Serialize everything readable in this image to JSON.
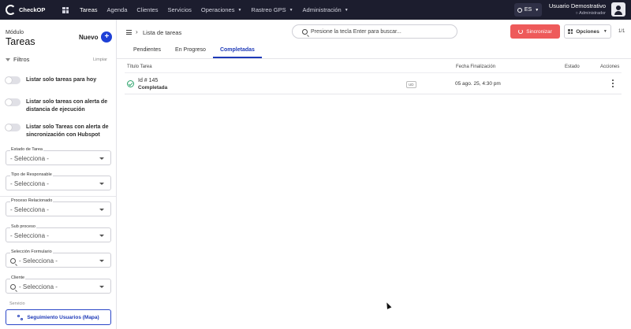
{
  "brand": {
    "name": "CheckOP"
  },
  "nav": {
    "items": [
      {
        "label": "Tareas",
        "active": true,
        "dropdown": false
      },
      {
        "label": "Agenda",
        "active": false,
        "dropdown": false
      },
      {
        "label": "Clientes",
        "active": false,
        "dropdown": false
      },
      {
        "label": "Servicios",
        "active": false,
        "dropdown": false
      },
      {
        "label": "Operaciones",
        "active": false,
        "dropdown": true
      },
      {
        "label": "Rastreo GPS",
        "active": false,
        "dropdown": true
      },
      {
        "label": "Administración",
        "active": false,
        "dropdown": true
      }
    ],
    "language": "ES",
    "user_name": "Usuario Demostrativo",
    "user_role": "Administrador"
  },
  "sidebar": {
    "module_label": "Módulo",
    "module_title": "Tareas",
    "new_label": "Nuevo",
    "filters_label": "Filtros",
    "clear_label": "Limpiar",
    "toggles": [
      {
        "label": "Listar solo tareas para hoy",
        "on": false
      },
      {
        "label": "Listar solo tareas con alerta de distancia de ejecución",
        "on": false
      },
      {
        "label": "Listar solo Tareas con alerta de sincronización con Hubspot",
        "on": false
      }
    ],
    "selects": [
      {
        "label": "Estado de Tarea",
        "value": "- Selecciona -",
        "search": false
      },
      {
        "label": "Tipo de Responsable",
        "value": "- Selecciona -",
        "search": false
      },
      {
        "label": "Proceso Relacionado",
        "value": "- Selecciona -",
        "search": false
      },
      {
        "label": "Sub proceso",
        "value": "- Selecciona -",
        "search": false
      },
      {
        "label": "Selección Formulario",
        "value": "- Selecciona -",
        "search": true
      },
      {
        "label": "Cliente",
        "value": "- Selecciona -",
        "search": true
      }
    ],
    "cut_label": "Servicio",
    "map_button": "Seguimiento Usuarios (Mapa)"
  },
  "main": {
    "breadcrumb": "Lista de tareas",
    "search_placeholder": "Presione la tecla Enter para buscar...",
    "sync_label": "Sincronizar",
    "options_label": "Opciones",
    "pager": "1/1",
    "tabs": [
      {
        "label": "Pendientes",
        "active": false
      },
      {
        "label": "En Progreso",
        "active": false
      },
      {
        "label": "Completadas",
        "active": true
      }
    ],
    "columns": {
      "title": "Título Tarea",
      "end_date": "Fecha Finalización",
      "status": "Estado",
      "actions": "Acciones"
    },
    "rows": [
      {
        "id": "Id # 145",
        "status": "Completada",
        "badge": "UD",
        "date": "05 ago. 25, 4:30 pm"
      }
    ]
  },
  "colors": {
    "topbar": "#1c1d2e",
    "primary": "#1e40d6",
    "sync": "#ee5a5a",
    "success": "#2ba36b"
  }
}
